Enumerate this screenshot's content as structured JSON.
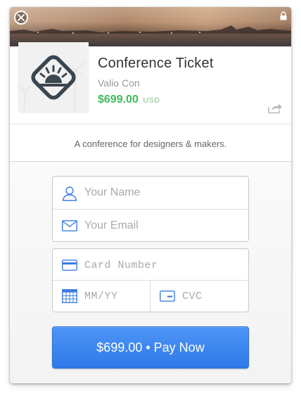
{
  "header": {
    "close_icon": "close-icon",
    "lock_icon": "lock-icon"
  },
  "product": {
    "title": "Conference Ticket",
    "subtitle": "Valio Con",
    "price": "$699.00",
    "currency": "USD",
    "logo_icon": "sun-diamond-logo",
    "share_icon": "share-icon",
    "price_color": "#3fbb5a"
  },
  "description": "A conference for designers & makers.",
  "form": {
    "name_placeholder": "Your Name",
    "email_placeholder": "Your Email",
    "card_placeholder": "Card Number",
    "expiry_placeholder": "MM/YY",
    "cvc_placeholder": "CVC",
    "icon_color": "#3d7de3"
  },
  "pay_button": {
    "label": "$699.00 • Pay Now",
    "color": "#3a86ef"
  }
}
